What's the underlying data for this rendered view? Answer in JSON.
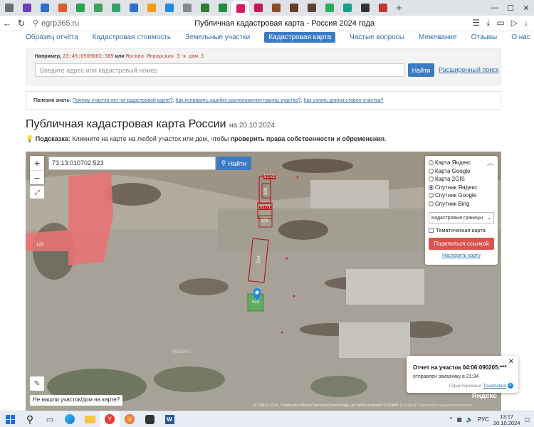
{
  "browser": {
    "tab_colors": [
      "#6d6d6d",
      "#6e3fbf",
      "#2c6fd1",
      "#e25b2c",
      "#2ba24c",
      "#3fa35a",
      "#2fa36c",
      "#2f6fd1",
      "#f39c12",
      "#1e88e5",
      "#888888",
      "#2e7d32",
      "#1d8f3c",
      "#d81b60",
      "#c2185b",
      "#8e4b2a",
      "#6a3a2a",
      "#5c4433",
      "#27ae60",
      "#16a085",
      "#333333",
      "#c0392b"
    ],
    "active_tab_index": 13,
    "url": "egrp365.ru",
    "title": "Публичная кадастровая карта - Россия 2024 года"
  },
  "site_nav": {
    "items": [
      "Образец отчёта",
      "Кадастровая стоимость",
      "Земельные участки",
      "Кадастровая карта",
      "Частые вопросы",
      "Межевание",
      "Отзывы",
      "О нас"
    ],
    "active_index": 3
  },
  "search": {
    "example_prefix": "Например,",
    "example_code": "23:49:0509002:385",
    "example_or": "или",
    "example_address": "Москва Январская 3-я дом 3",
    "placeholder": "Введите адрес или кадастровый номер",
    "button": "Найти",
    "advanced": "Расширенный поиск"
  },
  "useful": {
    "label": "Полезно знать:",
    "links": [
      "Почему участка нет на кадастровой карте?",
      "Как исправить ошибку расположения границ участка?",
      "Как узнать длины сторон участка?"
    ]
  },
  "heading": {
    "title": "Публичная кадастровая карта России",
    "date": "на 20.10.2024"
  },
  "hint": {
    "label": "Подсказка:",
    "text": "Кликните на карте на любой участок или дом, чтобы",
    "bold": "проверить права собственности и обременения",
    "end": "."
  },
  "map": {
    "zoom_in": "+",
    "zoom_out": "−",
    "cad_value": "73:13:010702:523",
    "cad_button": "Найти",
    "parcel_labels": [
      "517/2",
      "309",
      "517/1",
      "375",
      "519",
      "129",
      "523"
    ],
    "layers": [
      "Карта Яндекс",
      "Карта Google",
      "Карта 2GIS",
      "Спутник Яндекс",
      "Спутник Google",
      "Спутник Bing"
    ],
    "selected_layer_index": 3,
    "boundary_select": "Кадастровые границы",
    "thematic": "Тематическая карта",
    "share": "Поделиться ссылкой",
    "setup": "Настроить карту",
    "not_found": "Не нашли участок/дом на карте?",
    "attribution": "© CNES 2014, Distribution Airbus Services/Spot Image, all rights reserved © DOMP",
    "leaflet": "Leaflet",
    "attr_link": "Публичная кадастровая карта",
    "yandex": "Яндекс",
    "watermark": "Yandex"
  },
  "toast": {
    "title": "Отчет на участок 04:06:090205:***",
    "subtitle": "отправлен заказчику в 21:34",
    "trust_prefix": "Гарантировано",
    "trust_link": "TrustAction"
  },
  "taskbar": {
    "lang": "РУС",
    "time": "13:17",
    "date": "20.10.2024"
  }
}
